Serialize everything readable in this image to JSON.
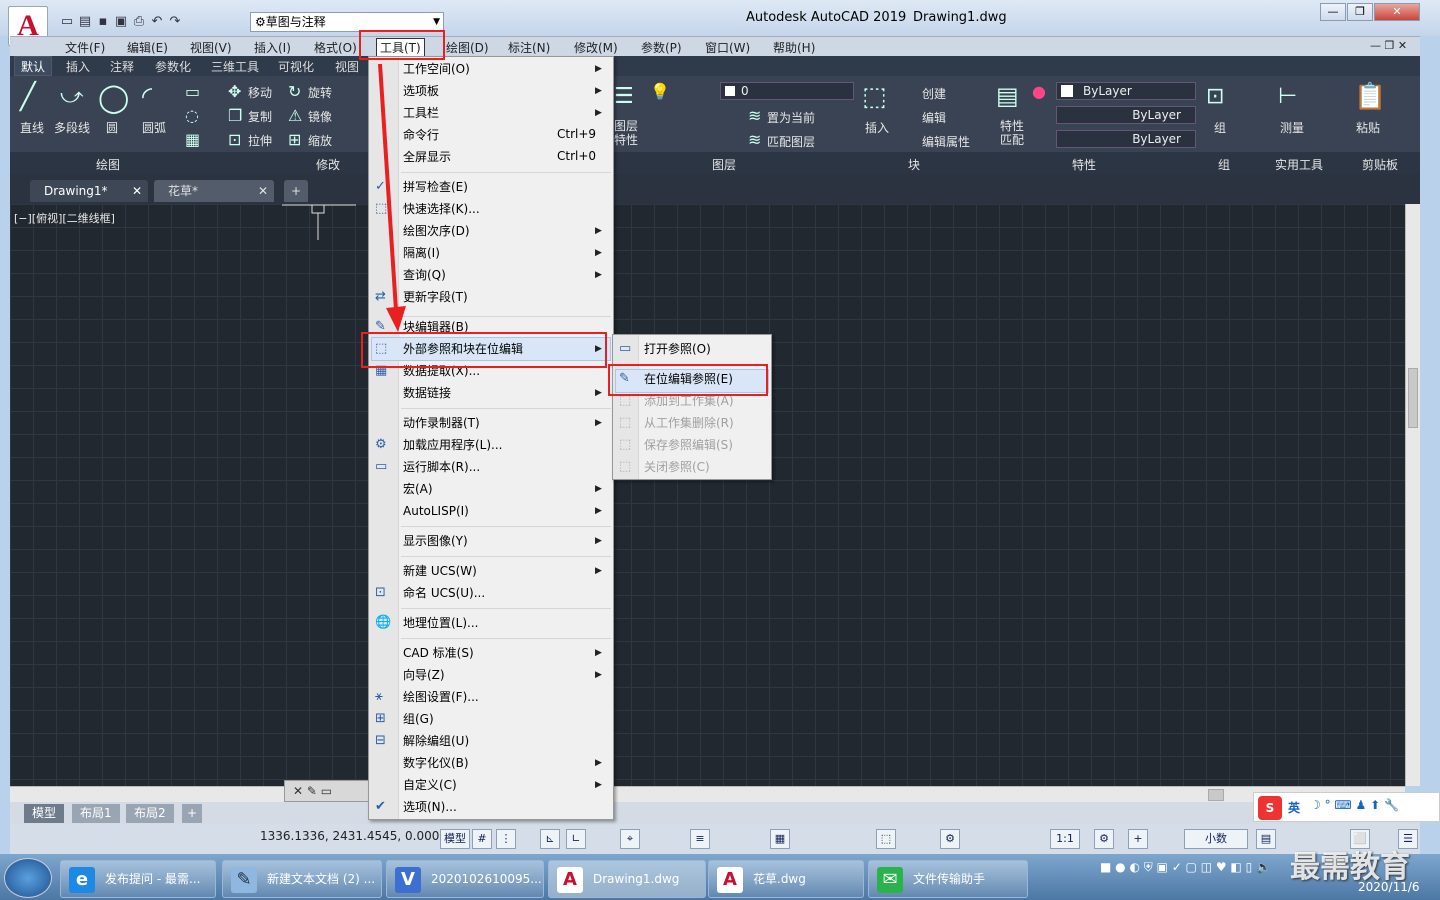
{
  "app": {
    "title": "Autodesk AutoCAD 2019",
    "file": "Drawing1.dwg",
    "logo": "A",
    "workspace": "草图与注释"
  },
  "menubar": [
    "文件(F)",
    "编辑(E)",
    "视图(V)",
    "插入(I)",
    "格式(O)",
    "工具(T)",
    "绘图(D)",
    "标注(N)",
    "修改(M)",
    "参数(P)",
    "窗口(W)",
    "帮助(H)"
  ],
  "ribbon_tabs": [
    "默认",
    "插入",
    "注释",
    "参数化",
    "三维工具",
    "可视化",
    "视图"
  ],
  "ribbon": {
    "draw": [
      "直线",
      "多段线",
      "圆",
      "圆弧"
    ],
    "draw_panel": "绘图",
    "modify": [
      "移动",
      "旋转",
      "复制",
      "镜像",
      "拉伸",
      "缩放"
    ],
    "modify_panel": "修改",
    "layer_panel": "图层",
    "layer_value": "0",
    "layer_cmds": [
      "置为当前",
      "匹配图层"
    ],
    "layer_prop": "图层\n特性",
    "block_panel": "块",
    "block_insert": "插入",
    "block_cmds": [
      "创建",
      "编辑",
      "编辑属性"
    ],
    "prop_panel": "特性",
    "prop_match": "特性\n匹配",
    "bylayer": [
      "ByLayer",
      "ByLayer",
      "ByLayer"
    ],
    "group": "组",
    "group_panel": "组",
    "measure": "测量",
    "util_panel": "实用工具",
    "paste": "粘贴",
    "clip_panel": "剪贴板"
  },
  "doc_tabs": [
    "Drawing1*",
    "花草*"
  ],
  "viewport_label": "[−][俯视][二维线框]",
  "tools_menu": [
    {
      "label": "工作空间(O)",
      "sub": true
    },
    {
      "label": "选项板",
      "sub": true
    },
    {
      "label": "工具栏",
      "sub": true
    },
    {
      "label": "命令行",
      "shortcut": "Ctrl+9"
    },
    {
      "label": "全屏显示",
      "shortcut": "Ctrl+0"
    },
    {
      "label": "拼写检查(E)"
    },
    {
      "label": "快速选择(K)..."
    },
    {
      "label": "绘图次序(D)",
      "sub": true
    },
    {
      "label": "隔离(I)",
      "sub": true
    },
    {
      "label": "查询(Q)",
      "sub": true
    },
    {
      "label": "更新字段(T)"
    },
    {
      "label": "块编辑器(B)"
    },
    {
      "label": "外部参照和块在位编辑",
      "sub": true
    },
    {
      "label": "数据提取(X)..."
    },
    {
      "label": "数据链接",
      "sub": true
    },
    {
      "label": "动作录制器(T)",
      "sub": true
    },
    {
      "label": "加载应用程序(L)..."
    },
    {
      "label": "运行脚本(R)..."
    },
    {
      "label": "宏(A)",
      "sub": true
    },
    {
      "label": "AutoLISP(I)",
      "sub": true
    },
    {
      "label": "显示图像(Y)",
      "sub": true
    },
    {
      "label": "新建 UCS(W)",
      "sub": true
    },
    {
      "label": "命名 UCS(U)..."
    },
    {
      "label": "地理位置(L)..."
    },
    {
      "label": "CAD 标准(S)",
      "sub": true
    },
    {
      "label": "向导(Z)",
      "sub": true
    },
    {
      "label": "绘图设置(F)..."
    },
    {
      "label": "组(G)"
    },
    {
      "label": "解除编组(U)"
    },
    {
      "label": "数字化仪(B)",
      "sub": true
    },
    {
      "label": "自定义(C)",
      "sub": true
    },
    {
      "label": "选项(N)..."
    }
  ],
  "xref_submenu": [
    {
      "label": "打开参照(O)",
      "enabled": true
    },
    {
      "label": "在位编辑参照(E)",
      "enabled": true
    },
    {
      "label": "添加到工作集(A)",
      "enabled": false
    },
    {
      "label": "从工作集删除(R)",
      "enabled": false
    },
    {
      "label": "保存参照编辑(S)",
      "enabled": false
    },
    {
      "label": "关闭参照(C)",
      "enabled": false
    }
  ],
  "layout_tabs": [
    "模型",
    "布局1",
    "布局2"
  ],
  "status": {
    "coords": "1336.1336, 2431.4545, 0.0000",
    "model": "模型",
    "scale": "1:1",
    "units": "小数"
  },
  "taskbar": [
    {
      "label": "发布提问 - 最需...",
      "icon": "e",
      "color": "#1e88e5"
    },
    {
      "label": "新建文本文档 (2) ...",
      "icon": "✎",
      "color": "#8fb7e0"
    },
    {
      "label": "2020102610095...",
      "icon": "V",
      "color": "#3d6fd1"
    },
    {
      "label": "Drawing1.dwg",
      "icon": "A",
      "color": "#c8102e"
    },
    {
      "label": "花草.dwg",
      "icon": "A",
      "color": "#c8102e"
    },
    {
      "label": "文件传输助手",
      "icon": "✉",
      "color": "#2bb24c"
    }
  ],
  "clock": {
    "date": "2020/11/6"
  },
  "ime": {
    "lang": "英"
  },
  "watermark": "最需教育",
  "accent_red": "#e82020"
}
